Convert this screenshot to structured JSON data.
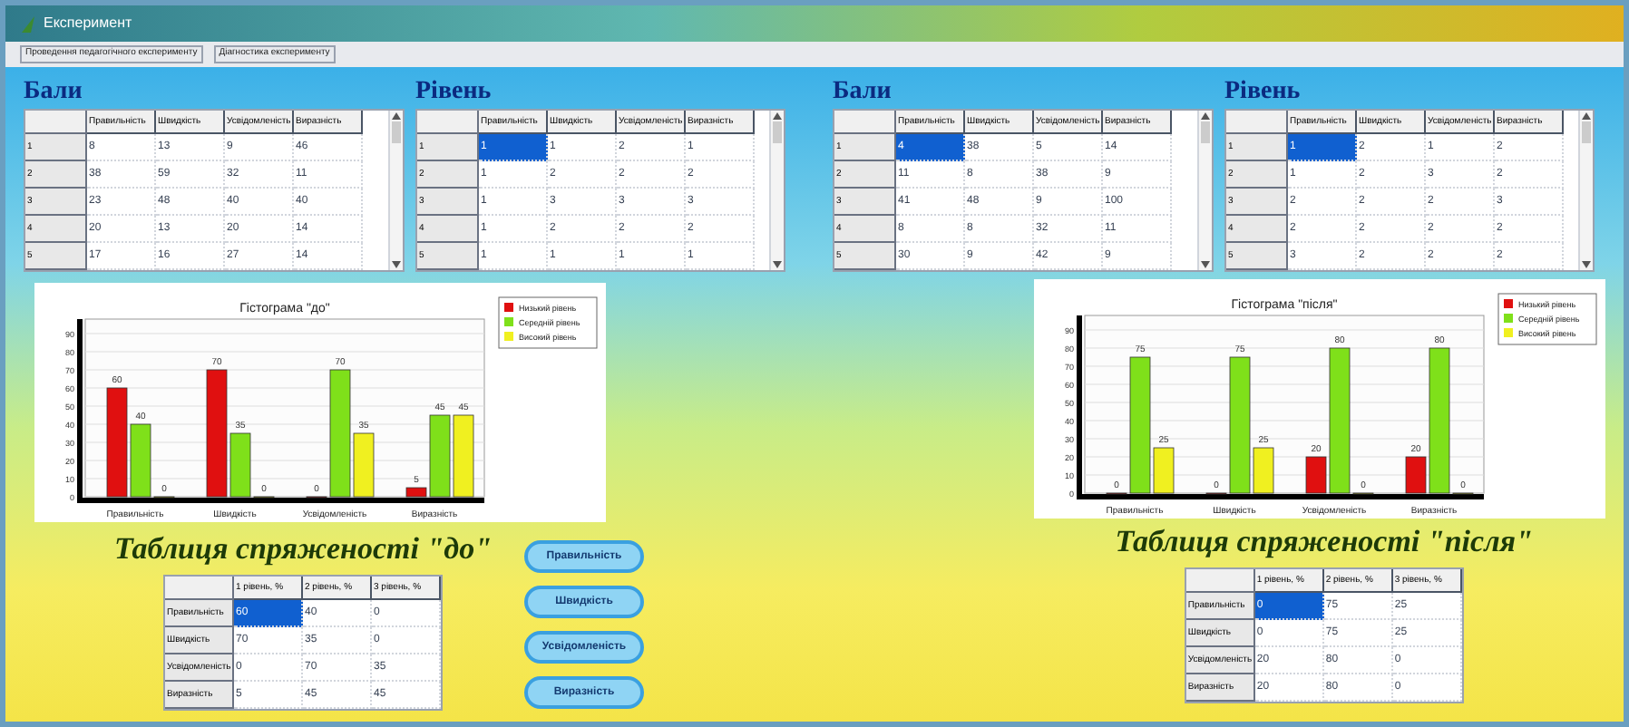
{
  "window": {
    "title": "Експеримент"
  },
  "menu": [
    {
      "label": "Проведення педагогічного експерименту"
    },
    {
      "label": "Діагностика експерименту"
    }
  ],
  "panels": [
    {
      "score_table": {
        "title": "Бали",
        "columns": [
          "Правильність",
          "Швидкість",
          "Усвідомленість",
          "Виразність"
        ],
        "rows": [
          {
            "header": "1",
            "cells": [
              {
                "text": "8",
                "selected": false
              },
              {
                "text": "13",
                "selected": false
              },
              {
                "text": "9",
                "selected": false
              },
              {
                "text": "46",
                "selected": false
              }
            ]
          },
          {
            "header": "2",
            "cells": [
              {
                "text": "38",
                "selected": false
              },
              {
                "text": "59",
                "selected": false
              },
              {
                "text": "32",
                "selected": false
              },
              {
                "text": "11",
                "selected": false
              }
            ]
          },
          {
            "header": "3",
            "cells": [
              {
                "text": "23",
                "selected": false
              },
              {
                "text": "48",
                "selected": false
              },
              {
                "text": "40",
                "selected": false
              },
              {
                "text": "40",
                "selected": false
              }
            ]
          },
          {
            "header": "4",
            "cells": [
              {
                "text": "20",
                "selected": false
              },
              {
                "text": "13",
                "selected": false
              },
              {
                "text": "20",
                "selected": false
              },
              {
                "text": "14",
                "selected": false
              }
            ]
          },
          {
            "header": "5",
            "cells": [
              {
                "text": "17",
                "selected": false
              },
              {
                "text": "16",
                "selected": false
              },
              {
                "text": "27",
                "selected": false
              },
              {
                "text": "14",
                "selected": false
              }
            ]
          }
        ]
      },
      "level_table": {
        "title": "Рівень",
        "columns": [
          "Правильність",
          "Швидкість",
          "Усвідомленість",
          "Виразність"
        ],
        "rows": [
          {
            "header": "1",
            "cells": [
              {
                "text": "1",
                "selected": true
              },
              {
                "text": "1",
                "selected": false
              },
              {
                "text": "2",
                "selected": false
              },
              {
                "text": "1",
                "selected": false
              }
            ]
          },
          {
            "header": "2",
            "cells": [
              {
                "text": "1",
                "selected": false
              },
              {
                "text": "2",
                "selected": false
              },
              {
                "text": "2",
                "selected": false
              },
              {
                "text": "2",
                "selected": false
              }
            ]
          },
          {
            "header": "3",
            "cells": [
              {
                "text": "1",
                "selected": false
              },
              {
                "text": "3",
                "selected": false
              },
              {
                "text": "3",
                "selected": false
              },
              {
                "text": "3",
                "selected": false
              }
            ]
          },
          {
            "header": "4",
            "cells": [
              {
                "text": "1",
                "selected": false
              },
              {
                "text": "2",
                "selected": false
              },
              {
                "text": "2",
                "selected": false
              },
              {
                "text": "2",
                "selected": false
              }
            ]
          },
          {
            "header": "5",
            "cells": [
              {
                "text": "1",
                "selected": false
              },
              {
                "text": "1",
                "selected": false
              },
              {
                "text": "1",
                "selected": false
              },
              {
                "text": "1",
                "selected": false
              }
            ]
          }
        ]
      },
      "chart": {
        "chart_data": {
          "type": "bar",
          "legend": true,
          "grid": true,
          "title": "Гістограма \"до\"",
          "categories": [
            "Правильність",
            "Швидкість",
            "Усвідомленість",
            "Виразність"
          ],
          "series": [
            {
              "name": "Низький рівень",
              "color": "#e01010",
              "values": [
                60,
                70,
                0,
                5
              ]
            },
            {
              "name": "Середній рівень",
              "color": "#7fe01a",
              "values": [
                40,
                35,
                70,
                45
              ]
            },
            {
              "name": "Високий рівень",
              "color": "#f0f020",
              "values": [
                0,
                0,
                35,
                45
              ]
            }
          ],
          "ylim": [
            0,
            90
          ],
          "yticks": [
            0,
            10,
            20,
            30,
            40,
            50,
            60,
            70,
            80,
            90
          ],
          "data_labels": true
        }
      },
      "contingency": {
        "title": "Таблиця спряженості \"до\"",
        "columns": [
          "1 рівень, %",
          "2 рівень, %",
          "3 рівень, %"
        ],
        "rows": [
          {
            "header": "Правильність",
            "cells": [
              {
                "text": "60",
                "selected": true
              },
              {
                "text": "40",
                "selected": false
              },
              {
                "text": "0",
                "selected": false
              }
            ]
          },
          {
            "header": "Швидкість",
            "cells": [
              {
                "text": "70",
                "selected": false
              },
              {
                "text": "35",
                "selected": false
              },
              {
                "text": "0",
                "selected": false
              }
            ]
          },
          {
            "header": "Усвідомленість",
            "cells": [
              {
                "text": "0",
                "selected": false
              },
              {
                "text": "70",
                "selected": false
              },
              {
                "text": "35",
                "selected": false
              }
            ]
          },
          {
            "header": "Виразність",
            "cells": [
              {
                "text": "5",
                "selected": false
              },
              {
                "text": "45",
                "selected": false
              },
              {
                "text": "45",
                "selected": false
              }
            ]
          }
        ]
      },
      "buttons": [
        "Правильність",
        "Швидкість",
        "Усвідомленість",
        "Виразність"
      ]
    },
    {
      "score_table": {
        "title": "Бали",
        "columns": [
          "Правильність",
          "Швидкість",
          "Усвідомленість",
          "Виразність"
        ],
        "rows": [
          {
            "header": "1",
            "cells": [
              {
                "text": "4",
                "selected": true
              },
              {
                "text": "38",
                "selected": false
              },
              {
                "text": "5",
                "selected": false
              },
              {
                "text": "14",
                "selected": false
              }
            ]
          },
          {
            "header": "2",
            "cells": [
              {
                "text": "11",
                "selected": false
              },
              {
                "text": "8",
                "selected": false
              },
              {
                "text": "38",
                "selected": false
              },
              {
                "text": "9",
                "selected": false
              }
            ]
          },
          {
            "header": "3",
            "cells": [
              {
                "text": "41",
                "selected": false
              },
              {
                "text": "48",
                "selected": false
              },
              {
                "text": "9",
                "selected": false
              },
              {
                "text": "100",
                "selected": false
              }
            ]
          },
          {
            "header": "4",
            "cells": [
              {
                "text": "8",
                "selected": false
              },
              {
                "text": "8",
                "selected": false
              },
              {
                "text": "32",
                "selected": false
              },
              {
                "text": "11",
                "selected": false
              }
            ]
          },
          {
            "header": "5",
            "cells": [
              {
                "text": "30",
                "selected": false
              },
              {
                "text": "9",
                "selected": false
              },
              {
                "text": "42",
                "selected": false
              },
              {
                "text": "9",
                "selected": false
              }
            ]
          }
        ]
      },
      "level_table": {
        "title": "Рівень",
        "columns": [
          "Правильність",
          "Швидкість",
          "Усвідомленість",
          "Виразність"
        ],
        "rows": [
          {
            "header": "1",
            "cells": [
              {
                "text": "1",
                "selected": true
              },
              {
                "text": "2",
                "selected": false
              },
              {
                "text": "1",
                "selected": false
              },
              {
                "text": "2",
                "selected": false
              }
            ]
          },
          {
            "header": "2",
            "cells": [
              {
                "text": "1",
                "selected": false
              },
              {
                "text": "2",
                "selected": false
              },
              {
                "text": "3",
                "selected": false
              },
              {
                "text": "2",
                "selected": false
              }
            ]
          },
          {
            "header": "3",
            "cells": [
              {
                "text": "2",
                "selected": false
              },
              {
                "text": "2",
                "selected": false
              },
              {
                "text": "2",
                "selected": false
              },
              {
                "text": "3",
                "selected": false
              }
            ]
          },
          {
            "header": "4",
            "cells": [
              {
                "text": "2",
                "selected": false
              },
              {
                "text": "2",
                "selected": false
              },
              {
                "text": "2",
                "selected": false
              },
              {
                "text": "2",
                "selected": false
              }
            ]
          },
          {
            "header": "5",
            "cells": [
              {
                "text": "3",
                "selected": false
              },
              {
                "text": "2",
                "selected": false
              },
              {
                "text": "2",
                "selected": false
              },
              {
                "text": "2",
                "selected": false
              }
            ]
          }
        ]
      },
      "chart": {
        "chart_data": {
          "type": "bar",
          "legend": true,
          "grid": true,
          "title": "Гістограма \"після\"",
          "categories": [
            "Правильність",
            "Швидкість",
            "Усвідомленість",
            "Виразність"
          ],
          "series": [
            {
              "name": "Низький рівень",
              "color": "#e01010",
              "values": [
                0,
                0,
                20,
                20
              ]
            },
            {
              "name": "Середній рівень",
              "color": "#7fe01a",
              "values": [
                75,
                75,
                80,
                80
              ]
            },
            {
              "name": "Високий рівень",
              "color": "#f0f020",
              "values": [
                25,
                25,
                0,
                0
              ]
            }
          ],
          "ylim": [
            0,
            90
          ],
          "yticks": [
            0,
            10,
            20,
            30,
            40,
            50,
            60,
            70,
            80,
            90
          ],
          "data_labels": true
        }
      },
      "contingency": {
        "title": "Таблиця спряженості \"після\"",
        "columns": [
          "1 рівень, %",
          "2 рівень, %",
          "3 рівень, %"
        ],
        "rows": [
          {
            "header": "Правильність",
            "cells": [
              {
                "text": "0",
                "selected": true
              },
              {
                "text": "75",
                "selected": false
              },
              {
                "text": "25",
                "selected": false
              }
            ]
          },
          {
            "header": "Швидкість",
            "cells": [
              {
                "text": "0",
                "selected": false
              },
              {
                "text": "75",
                "selected": false
              },
              {
                "text": "25",
                "selected": false
              }
            ]
          },
          {
            "header": "Усвідомленість",
            "cells": [
              {
                "text": "20",
                "selected": false
              },
              {
                "text": "80",
                "selected": false
              },
              {
                "text": "0",
                "selected": false
              }
            ]
          },
          {
            "header": "Виразність",
            "cells": [
              {
                "text": "20",
                "selected": false
              },
              {
                "text": "80",
                "selected": false
              },
              {
                "text": "0",
                "selected": false
              }
            ]
          }
        ]
      }
    }
  ]
}
